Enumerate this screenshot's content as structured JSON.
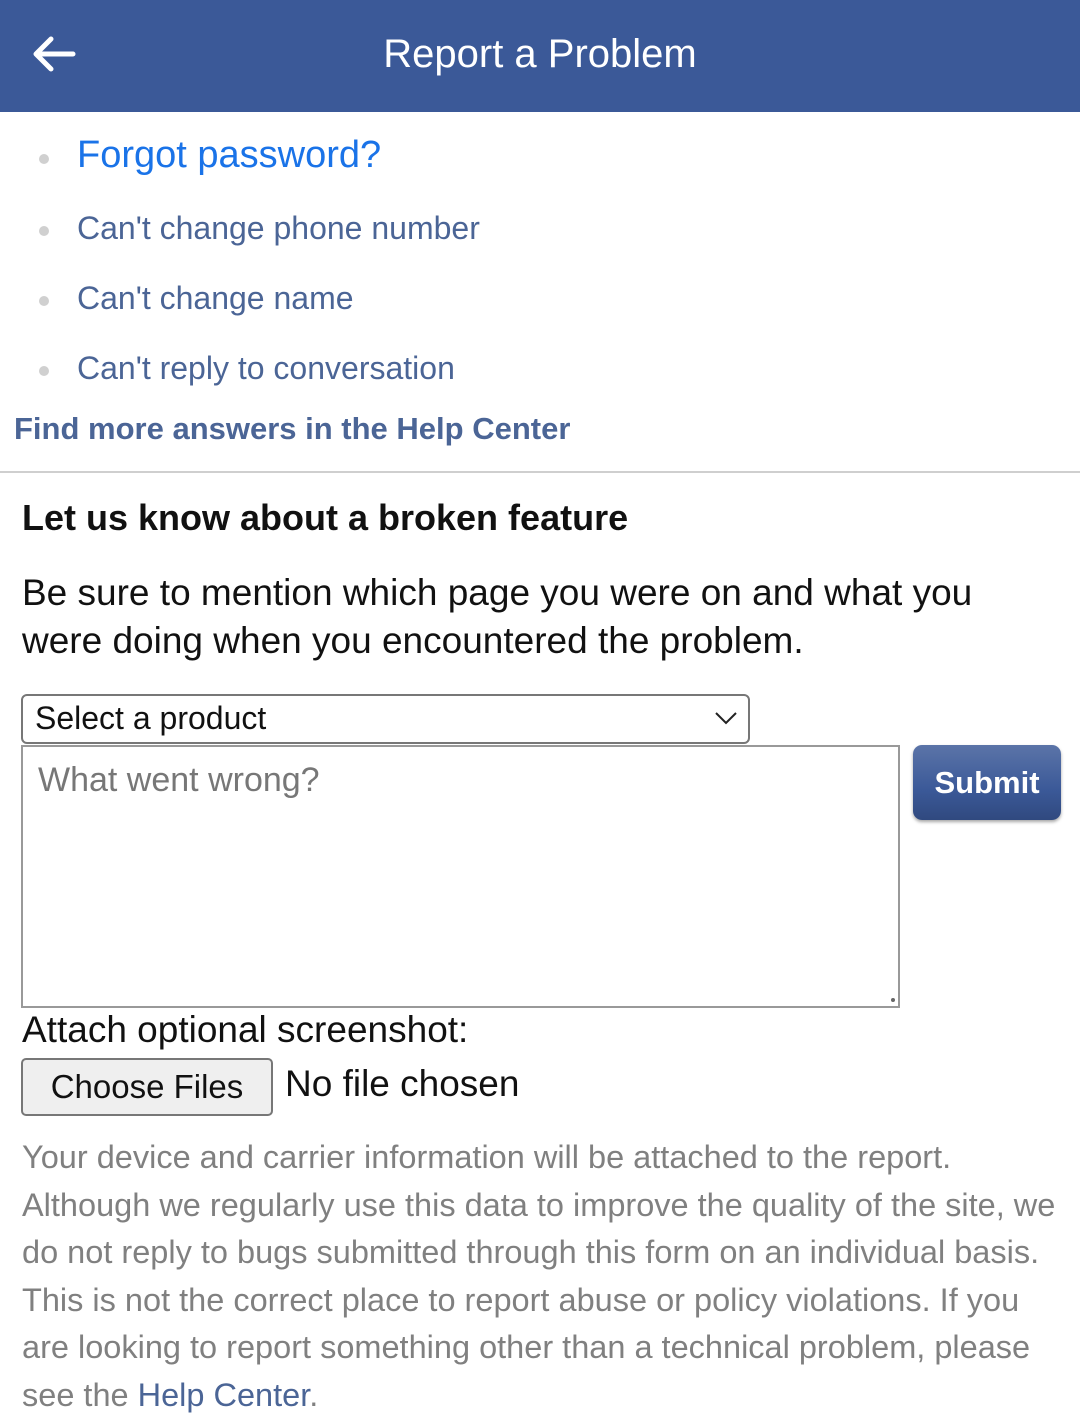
{
  "header": {
    "title": "Report a Problem",
    "back_icon": "arrow-left-icon",
    "background_color": "#3b5998"
  },
  "faq": {
    "items": [
      {
        "label": "Forgot password?"
      },
      {
        "label": "Can't change phone number"
      },
      {
        "label": "Can't change name"
      },
      {
        "label": "Can't reply to conversation"
      }
    ],
    "help_link": "Find more answers in the Help Center"
  },
  "form": {
    "title": "Let us know about a broken feature",
    "description": "Be sure to mention which page you were on and what you were doing when you encountered the problem.",
    "product_select": {
      "value": "Select a product",
      "icon": "chevron-down-icon"
    },
    "problem_input": {
      "placeholder": "What went wrong?",
      "value": ""
    },
    "submit_label": "Submit",
    "attach_label": "Attach optional screenshot:",
    "choose_files_label": "Choose Files",
    "file_status": "No file chosen"
  },
  "disclaimer": {
    "text": "Your device and carrier information will be attached to the report. Although we regularly use this data to improve the quality of the site, we do not reply to bugs submitted through this form on an individual basis. This is not the correct place to report abuse or policy violations. If you are looking to report something other than a technical problem, please see the ",
    "link_label": "Help Center",
    "suffix": "."
  },
  "colors": {
    "brand": "#3b5998",
    "link": "#4b6596",
    "primary_link": "#1a73e8",
    "muted_text": "#808080"
  }
}
